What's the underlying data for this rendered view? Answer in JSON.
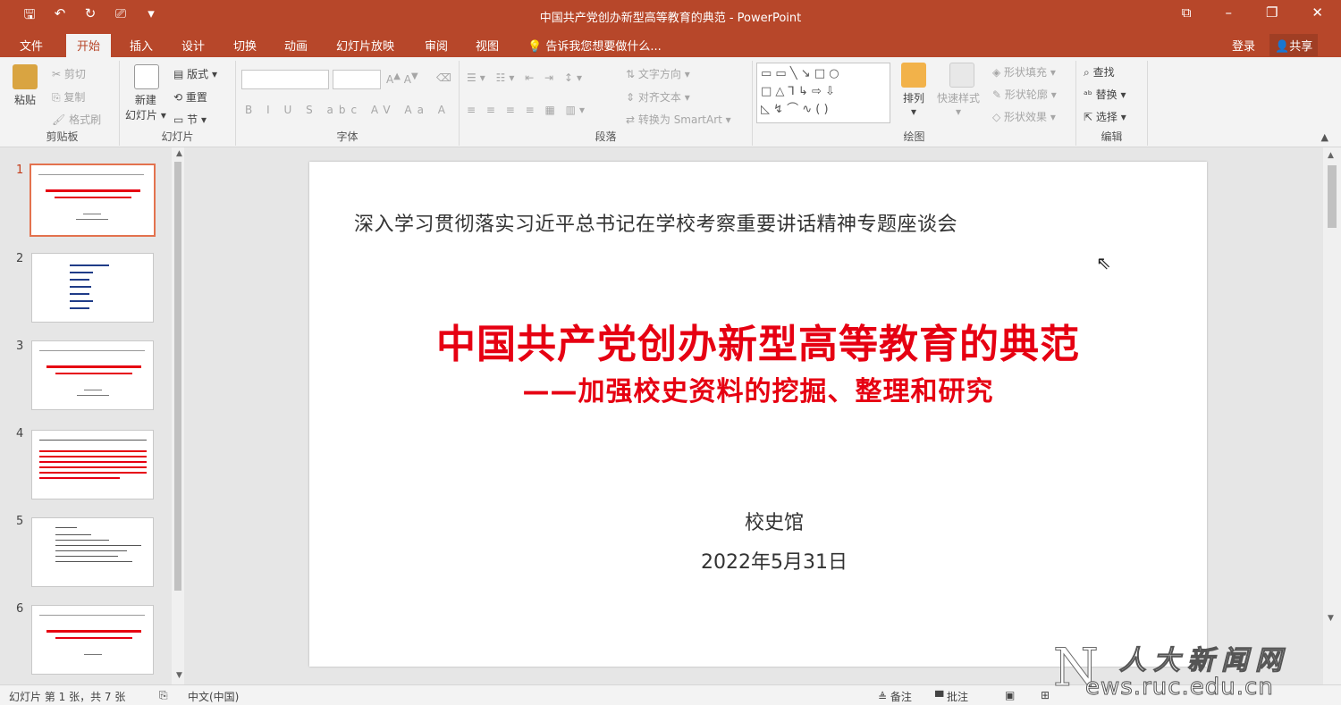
{
  "window": {
    "title": "中国共产党创办新型高等教育的典范 - PowerPoint",
    "qat_icons": [
      "save-icon",
      "undo-icon",
      "redo-icon",
      "present-icon",
      "customize-icon"
    ],
    "controls": [
      "ribbon-display-icon",
      "minimize-icon",
      "restore-icon",
      "close-icon"
    ]
  },
  "tabs": {
    "file": "文件",
    "home": "开始",
    "insert": "插入",
    "design": "设计",
    "transitions": "切换",
    "animations": "动画",
    "slideshow": "幻灯片放映",
    "review": "审阅",
    "view": "视图",
    "tellme": "告诉我您想要做什么...",
    "login": "登录",
    "share": "共享"
  },
  "ribbon": {
    "clipboard": {
      "paste": "粘贴",
      "cut": "剪切",
      "copy": "复制",
      "format_painter": "格式刷",
      "label": "剪贴板"
    },
    "slides": {
      "new_slide": "新建",
      "new_slide2": "幻灯片",
      "layout": "版式",
      "reset": "重置",
      "section": "节",
      "label": "幻灯片"
    },
    "font": {
      "label": "字体",
      "buttons": [
        "B",
        "I",
        "U",
        "S",
        "abc",
        "AV",
        "Aa",
        "A"
      ]
    },
    "paragraph": {
      "text_direction": "文字方向",
      "align_text": "对齐文本",
      "smartart": "转换为 SmartArt",
      "label": "段落"
    },
    "drawing": {
      "arrange": "排列",
      "quick_styles": "快速样式",
      "shape_fill": "形状填充",
      "shape_outline": "形状轮廓",
      "shape_effects": "形状效果",
      "label": "绘图"
    },
    "editing": {
      "find": "查找",
      "replace": "替换",
      "select": "选择",
      "label": "编辑"
    }
  },
  "thumbnails": [
    "1",
    "2",
    "3",
    "4",
    "5",
    "6"
  ],
  "slide": {
    "subtitle": "深入学习贯彻落实习近平总书记在学校考察重要讲话精神专题座谈会",
    "title": "中国共产党创办新型高等教育的典范",
    "title2": "——加强校史资料的挖掘、整理和研究",
    "org": "校史馆",
    "date": "2022年5月31日"
  },
  "status": {
    "slide_info": "幻灯片 第 1 张，共 7 张",
    "language": "中文(中国)",
    "notes": "备注",
    "comments": "批注"
  },
  "watermark": {
    "logo_letter": "N",
    "cn": "人大新闻网",
    "url": "ews.ruc.edu.cn"
  }
}
